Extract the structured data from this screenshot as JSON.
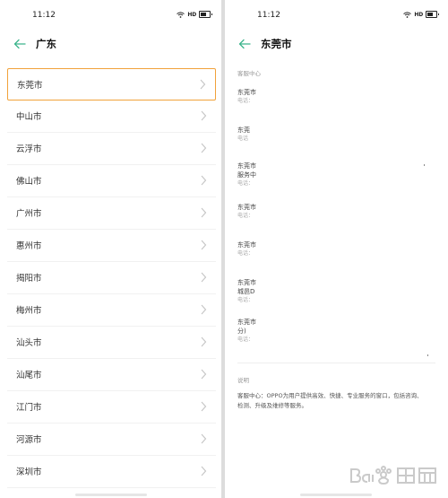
{
  "left_screen": {
    "status": {
      "time": "11:12",
      "hd": "HD"
    },
    "title": "广东",
    "cities": [
      "东莞市",
      "中山市",
      "云浮市",
      "佛山市",
      "广州市",
      "惠州市",
      "揭阳市",
      "梅州市",
      "汕头市",
      "汕尾市",
      "江门市",
      "河源市",
      "深圳市"
    ],
    "selected_index": 0
  },
  "right_screen": {
    "status": {
      "time": "11:12",
      "hd": "HD"
    },
    "title": "东莞市",
    "section_label": "客服中心",
    "centers": [
      {
        "name": "东莞市",
        "name_line2": "",
        "sub": "电话："
      },
      {
        "name": "东莞",
        "name_line2": "",
        "sub": "电话"
      },
      {
        "name": "东莞市",
        "name_line2": "服务中",
        "sub": "电话："
      },
      {
        "name": "东莞市",
        "name_line2": "",
        "sub": "电话："
      },
      {
        "name": "东莞市",
        "name_line2": "",
        "sub": "电话："
      },
      {
        "name": "东莞市",
        "name_line2": "城邑D",
        "sub": "电话："
      },
      {
        "name": "东莞市",
        "name_line2": "分)",
        "sub": "电话："
      }
    ],
    "description_label": "说明",
    "description": "客服中心：OPPO为用户提供高效、快捷、专业服务的窗口，包括咨询、检测、升级及维修等服务。"
  },
  "colors": {
    "accent": "#3cb48c",
    "selected_border": "#f1a23a"
  },
  "icons": {
    "back": "back-arrow-icon",
    "chevron": "chevron-right-icon",
    "wifi": "wifi-icon",
    "battery": "battery-icon"
  }
}
